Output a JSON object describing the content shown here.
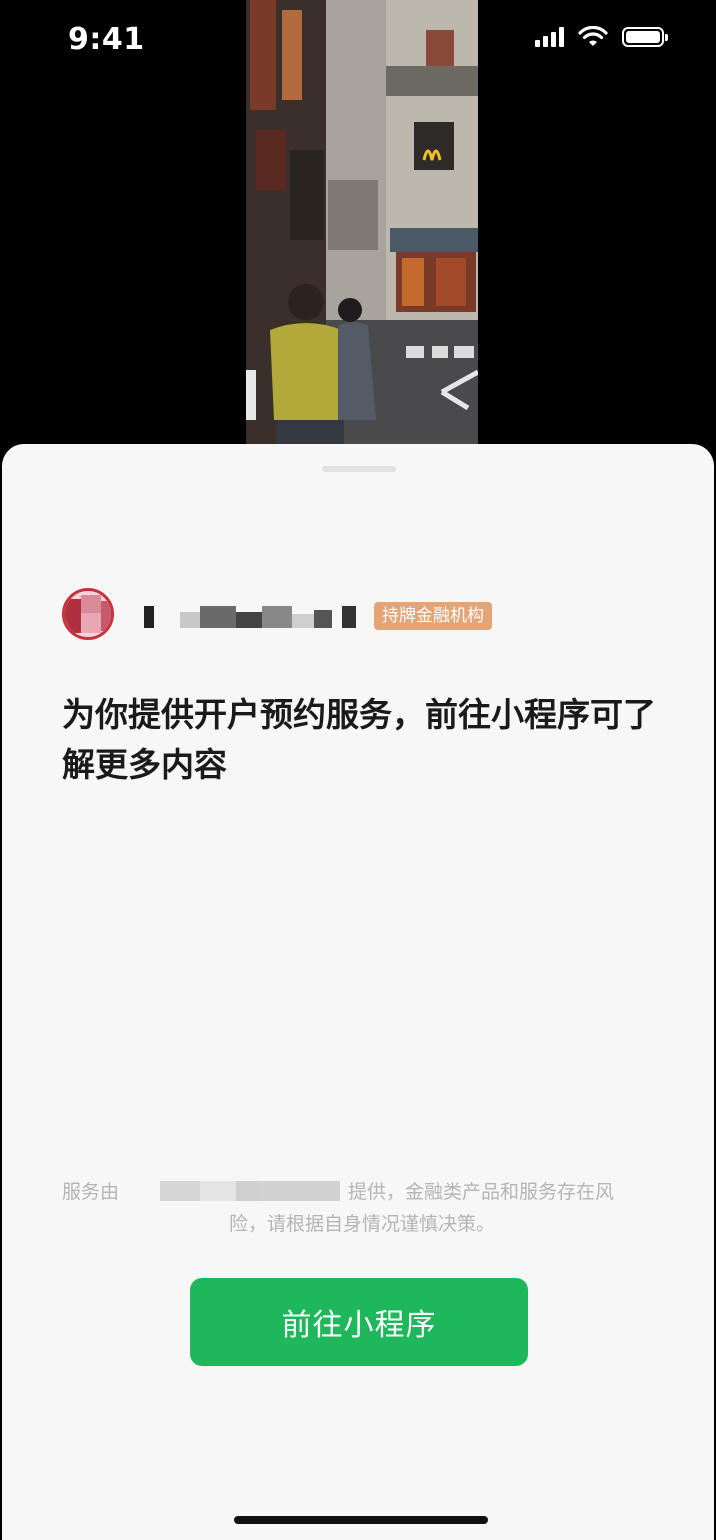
{
  "status_bar": {
    "time": "9:41"
  },
  "sheet": {
    "brand": {
      "badge": "持牌金融机构"
    },
    "headline": "为你提供开户预约服务，前往小程序可了解更多内容",
    "disclaimer": {
      "prefix": "服务由",
      "suffix": "提供，金融类产品和服务存在风",
      "line2": "险，请根据自身情况谨慎决策。"
    },
    "cta_label": "前往小程序"
  },
  "colors": {
    "accent_green": "#1fb75b",
    "badge_orange": "#e3a476",
    "sheet_bg": "#f7f7f7",
    "avatar_red": "#c8323c"
  },
  "icons": [
    "signal-icon",
    "wifi-icon",
    "battery-icon"
  ]
}
